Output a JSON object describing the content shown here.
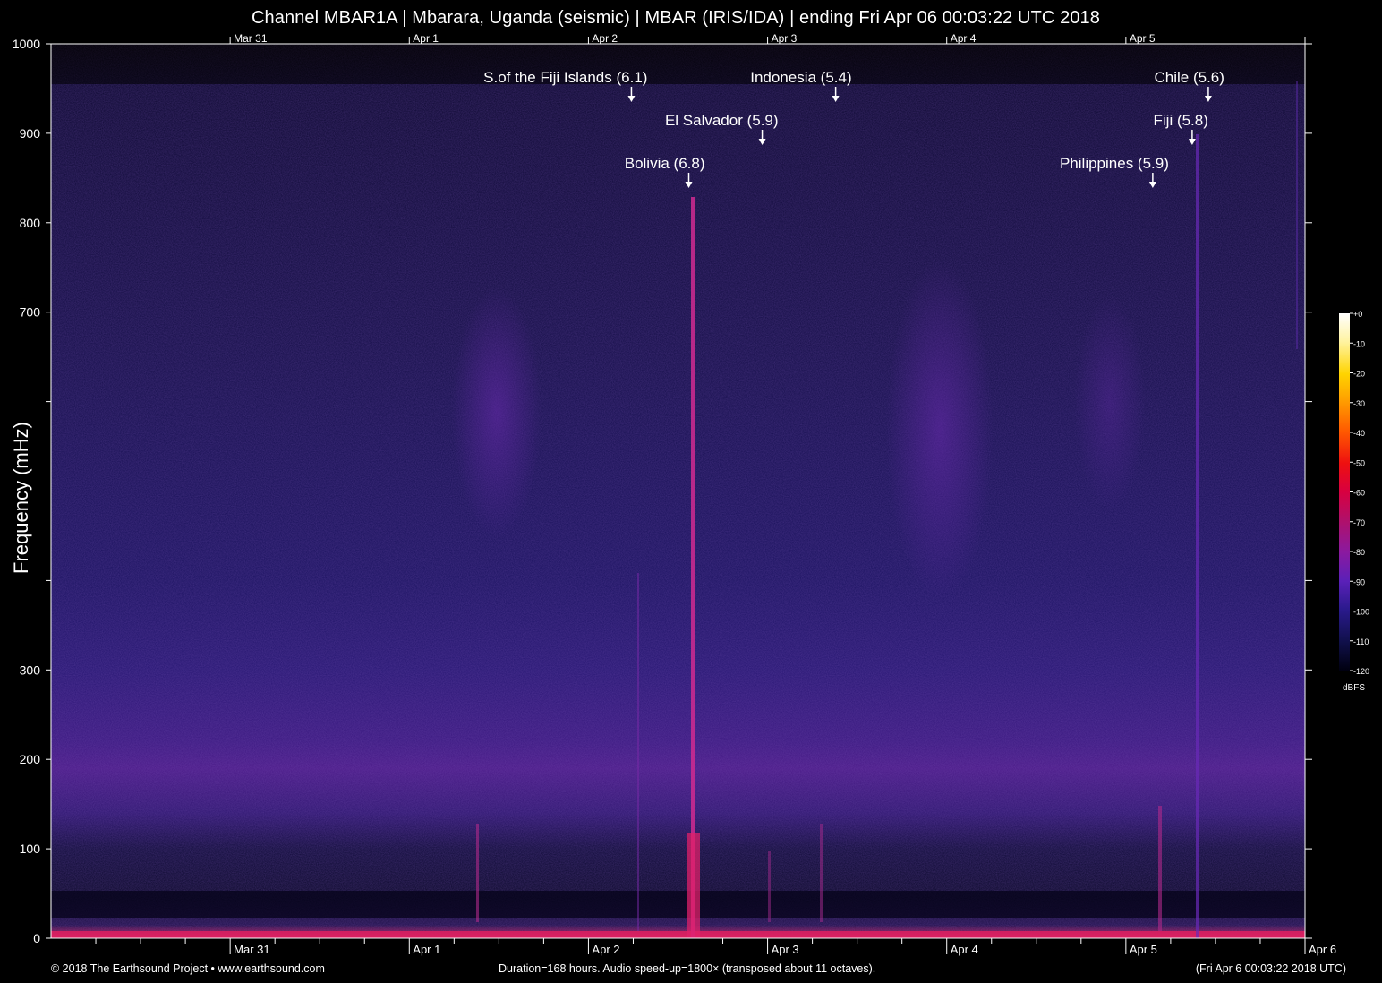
{
  "chart_data": {
    "type": "heatmap",
    "title": "Channel MBAR1A | Mbarara, Uganda (seismic) | MBAR (IRIS/IDA) | ending Fri Apr 06 00:03:22 UTC 2018",
    "ylabel": "Frequency (mHz)",
    "ylim": [
      0,
      1000
    ],
    "y_ticks": [
      0,
      100,
      200,
      300,
      400,
      500,
      600,
      700,
      800,
      900,
      1000
    ],
    "y_tick_labels": [
      "0",
      "100",
      "200",
      "300",
      "",
      "",
      "",
      "700",
      "800",
      "900",
      "1000"
    ],
    "x_ticks": [
      {
        "day": 1,
        "label": "Mar 31"
      },
      {
        "day": 2,
        "label": "Apr 1"
      },
      {
        "day": 3,
        "label": "Apr 2"
      },
      {
        "day": 4,
        "label": "Apr 3"
      },
      {
        "day": 5,
        "label": "Apr 4"
      },
      {
        "day": 6,
        "label": "Apr 5"
      },
      {
        "day": 7,
        "label": "Apr 6"
      }
    ],
    "x_range_days": [
      0,
      7
    ],
    "events": [
      {
        "label": "S.of the Fiji Islands (6.1)",
        "day": 3.24,
        "row": 0,
        "align": "right"
      },
      {
        "label": "Indonesia (5.4)",
        "day": 4.38,
        "row": 0,
        "align": "right"
      },
      {
        "label": "Chile (5.6)",
        "day": 6.46,
        "row": 0,
        "align": "right"
      },
      {
        "label": "El Salvador (5.9)",
        "day": 3.97,
        "row": 1,
        "align": "right"
      },
      {
        "label": "Fiji (5.8)",
        "day": 6.37,
        "row": 1,
        "align": "right"
      },
      {
        "label": "Bolivia (6.8)",
        "day": 3.56,
        "row": 2,
        "align": "right"
      },
      {
        "label": "Philippines (5.9)",
        "day": 6.15,
        "row": 2,
        "align": "right"
      }
    ],
    "colorbar": {
      "unit": "dBFS",
      "ticks": [
        0,
        -10,
        -20,
        -30,
        -40,
        -50,
        -60,
        -70,
        -80,
        -90,
        -100,
        -110,
        -120
      ],
      "tick_labels": [
        "+0",
        "-10",
        "-20",
        "-30",
        "-40",
        "-50",
        "-60",
        "-70",
        "-80",
        "-90",
        "-100",
        "-110",
        "-120"
      ],
      "colors": [
        "#ffffff",
        "#fff3a0",
        "#ffd400",
        "#ff9a00",
        "#ff5a00",
        "#ee1010",
        "#d80040",
        "#b0106a",
        "#8a1aa0",
        "#5a20b8",
        "#2a1a8c",
        "#10104a",
        "#000010"
      ]
    }
  },
  "footer": {
    "left": "© 2018 The Earthsound Project • www.earthsound.com",
    "center": "Duration=168 hours. Audio speed-up=1800× (transposed about 11 octaves).",
    "right": "(Fri Apr  6 00:03:22 2018 UTC)"
  }
}
